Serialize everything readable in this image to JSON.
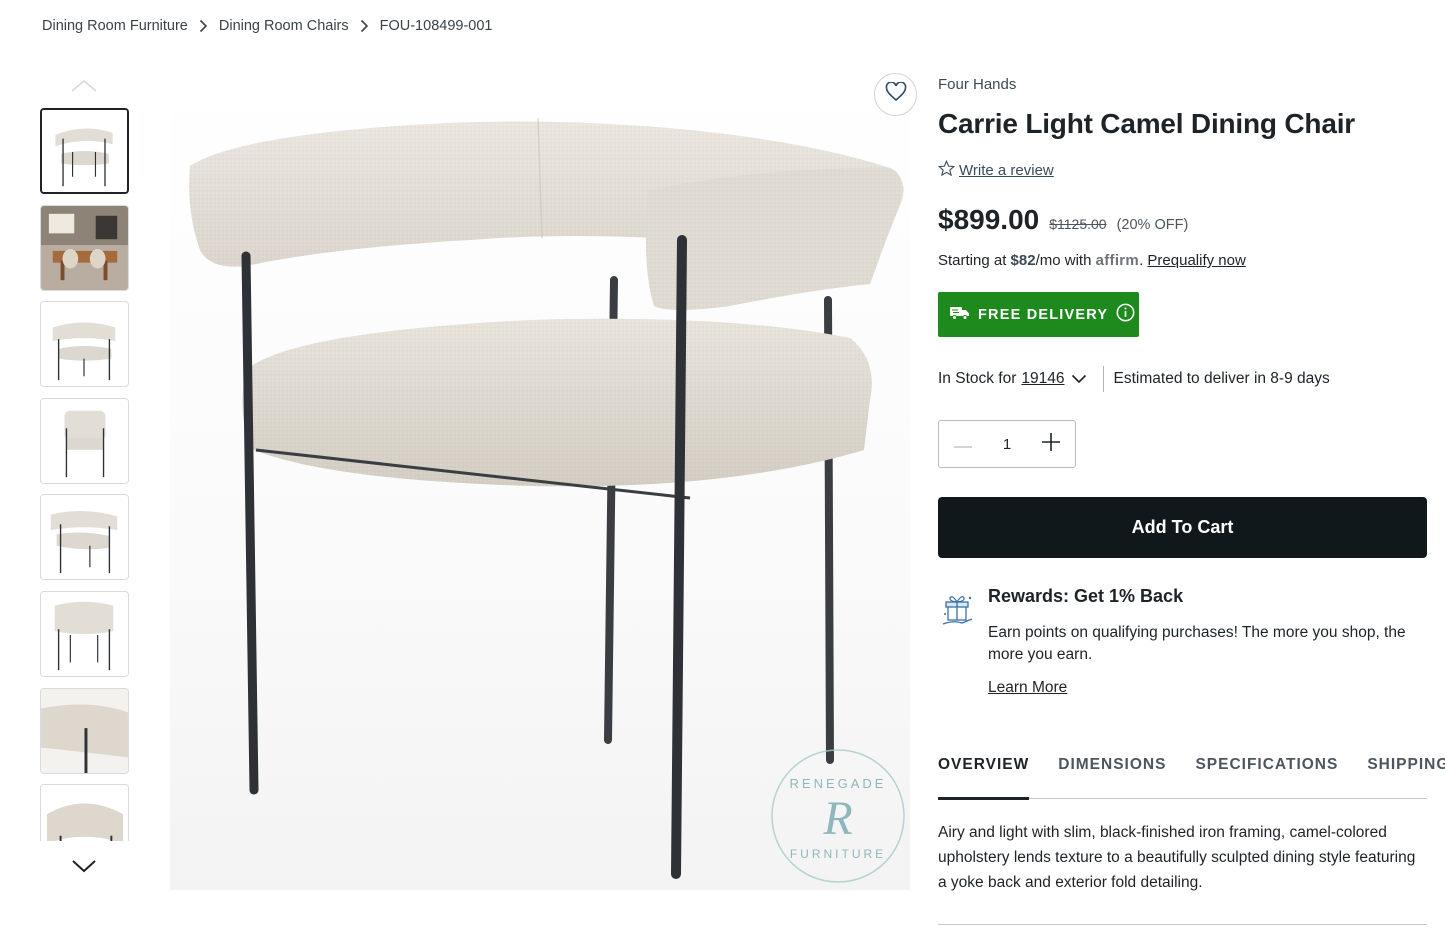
{
  "breadcrumb": {
    "items": [
      "Dining Room Furniture",
      "Dining Room Chairs",
      "FOU-108499-001"
    ]
  },
  "gallery": {
    "thumbnails": [
      "chair-front",
      "room-scene",
      "chair-angle",
      "chair-side",
      "chair-back-angle",
      "chair-back",
      "chair-detail",
      "chair-closeup"
    ],
    "active_index": 0,
    "watermark": [
      "RENEGADE",
      "R",
      "FURNITURE"
    ]
  },
  "product": {
    "brand": "Four Hands",
    "title": "Carrie Light Camel Dining Chair",
    "review_link": "Write a review",
    "price": "$899.00",
    "original_price": "$1125.00",
    "discount": "(20% OFF)",
    "financing": {
      "prefix": "Starting at ",
      "amount": "$82",
      "middle": "/mo with ",
      "provider": "affirm",
      "suffix": ". ",
      "link": "Prequalify now"
    },
    "delivery_badge": "FREE DELIVERY",
    "stock": {
      "label": "In Stock for",
      "zip": "19146",
      "estimate": "Estimated to deliver in 8-9 days"
    },
    "quantity": "1",
    "add_to_cart": "Add To Cart"
  },
  "rewards": {
    "title": "Rewards: Get 1% Back",
    "description": "Earn points on qualifying purchases! The more you shop, the more you earn.",
    "link": "Learn More"
  },
  "tabs": {
    "items": [
      "OVERVIEW",
      "DIMENSIONS",
      "SPECIFICATIONS",
      "SHIPPING"
    ],
    "active": "OVERVIEW"
  },
  "overview": {
    "text": "Airy and light with slim, black-finished iron framing, camel-colored upholstery lends texture to a beautifully sculpted dining style featuring a yoke back and exterior fold detailing."
  },
  "colors": {
    "delivery_green": "#1e8a1e",
    "cart_black": "#11181c",
    "affirm_blue": "#4a4af4",
    "fabric": "#e4dfd7",
    "frame": "#2e3236"
  }
}
